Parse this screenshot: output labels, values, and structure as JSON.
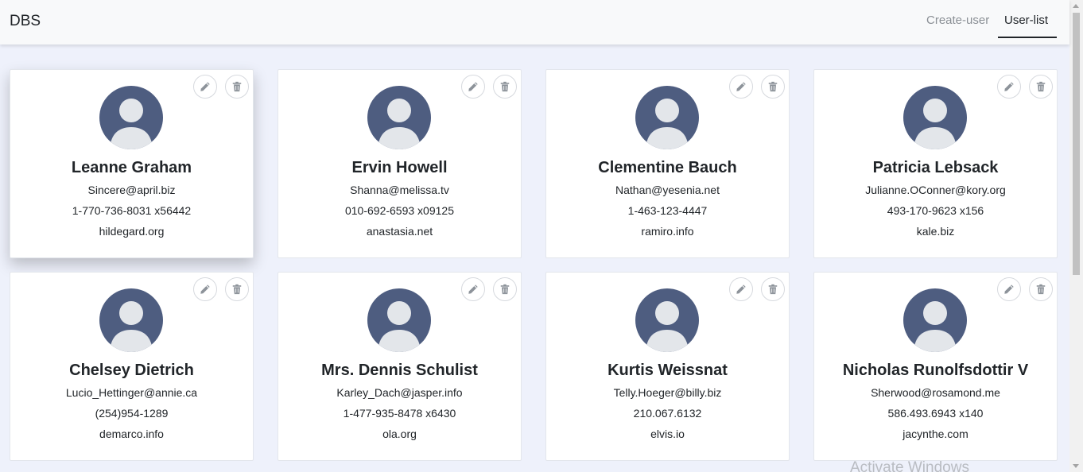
{
  "header": {
    "brand": "DBS",
    "nav": [
      {
        "label": "Create-user",
        "active": false
      },
      {
        "label": "User-list",
        "active": true
      }
    ]
  },
  "icons": {
    "edit": "pencil-icon",
    "delete": "trash-icon",
    "avatar": "user-avatar-icon"
  },
  "colors": {
    "avatar_bg": "#4e5d80",
    "avatar_figure": "#e3e6ea",
    "page_bg": "#eef1fb"
  },
  "users": [
    {
      "name": "Leanne Graham",
      "email": "Sincere@april.biz",
      "phone": "1-770-736-8031 x56442",
      "website": "hildegard.org"
    },
    {
      "name": "Ervin Howell",
      "email": "Shanna@melissa.tv",
      "phone": "010-692-6593 x09125",
      "website": "anastasia.net"
    },
    {
      "name": "Clementine Bauch",
      "email": "Nathan@yesenia.net",
      "phone": "1-463-123-4447",
      "website": "ramiro.info"
    },
    {
      "name": "Patricia Lebsack",
      "email": "Julianne.OConner@kory.org",
      "phone": "493-170-9623 x156",
      "website": "kale.biz"
    },
    {
      "name": "Chelsey Dietrich",
      "email": "Lucio_Hettinger@annie.ca",
      "phone": "(254)954-1289",
      "website": "demarco.info"
    },
    {
      "name": "Mrs. Dennis Schulist",
      "email": "Karley_Dach@jasper.info",
      "phone": "1-477-935-8478 x6430",
      "website": "ola.org"
    },
    {
      "name": "Kurtis Weissnat",
      "email": "Telly.Hoeger@billy.biz",
      "phone": "210.067.6132",
      "website": "elvis.io"
    },
    {
      "name": "Nicholas Runolfsdottir V",
      "email": "Sherwood@rosamond.me",
      "phone": "586.493.6943 x140",
      "website": "jacynthe.com"
    }
  ],
  "watermark": "Activate Windows"
}
